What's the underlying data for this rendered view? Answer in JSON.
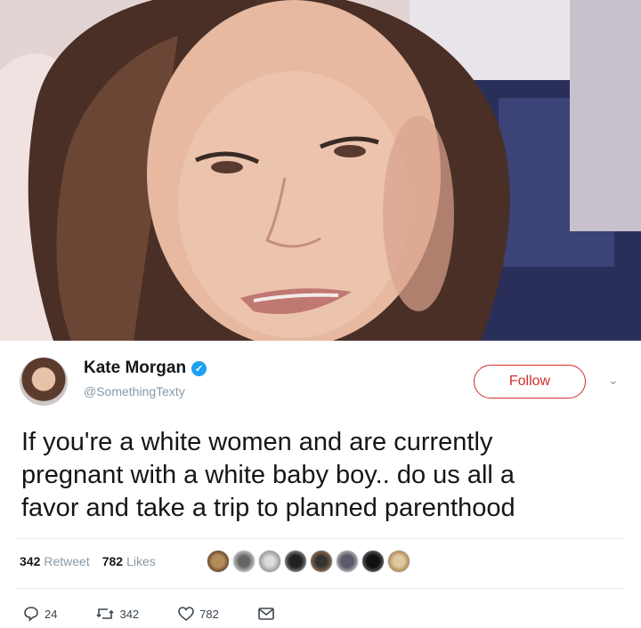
{
  "tweet": {
    "name": "Kate Morgan",
    "handle": "@SomethingTexty",
    "follow_label": "Follow",
    "text_lines": [
      "If you're a white women and are currently",
      "pregnant with a white baby boy.. do us all a",
      "favor and take a trip to planned parenthood"
    ],
    "retweet_count": "342",
    "retweet_label": "Retweet",
    "like_count": "782",
    "like_label": "Likes",
    "reply_count": "24",
    "action_retweet_count": "342",
    "action_like_count": "782"
  },
  "icons": {
    "verified": "verified-badge-icon",
    "caret": "chevron-down-icon",
    "reply": "reply-icon",
    "retweet": "retweet-icon",
    "like": "heart-icon",
    "dm": "direct-message-icon"
  },
  "colors": {
    "follow_red": "#d42d2d",
    "verified_blue": "#1da1f2",
    "muted_gray": "#8899a6"
  }
}
